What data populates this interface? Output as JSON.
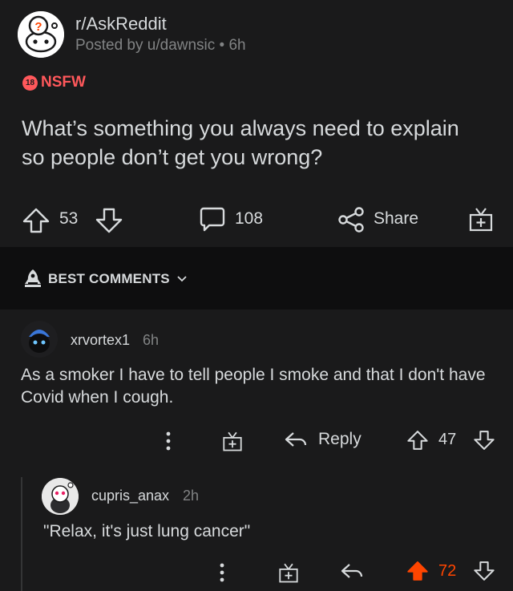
{
  "post": {
    "subreddit": "r/AskReddit",
    "posted_by": "Posted by u/dawnsic • 6h",
    "nsfw_badge": "18",
    "nsfw_label": "NSFW",
    "title": "What’s something you always need to explain so people don’t get you wrong?",
    "score": "53",
    "comments": "108",
    "share_label": "Share"
  },
  "sort": {
    "label": "BEST COMMENTS"
  },
  "comments": [
    {
      "username": "xrvortex1",
      "time": "6h",
      "body": "As a smoker I have to tell people I smoke and that I don't have Covid when I cough.",
      "reply_label": "Reply",
      "score": "47"
    },
    {
      "username": "cupris_anax",
      "time": "2h",
      "body": "\"Relax, it's just lung cancer\"",
      "score": "72",
      "upvoted": true
    }
  ],
  "colors": {
    "background": "#1a1a1b",
    "sortbar": "#0e0e0f",
    "text": "#d7dadc",
    "muted": "#818384",
    "nsfw": "#ff585b",
    "upvote": "#ff4500"
  },
  "icons": [
    "subreddit-avatar-icon",
    "upvote-icon",
    "downvote-icon",
    "comment-bubble-icon",
    "share-icon",
    "award-icon",
    "rocket-icon",
    "chevron-down-icon",
    "more-dots-icon",
    "reply-arrow-icon"
  ]
}
